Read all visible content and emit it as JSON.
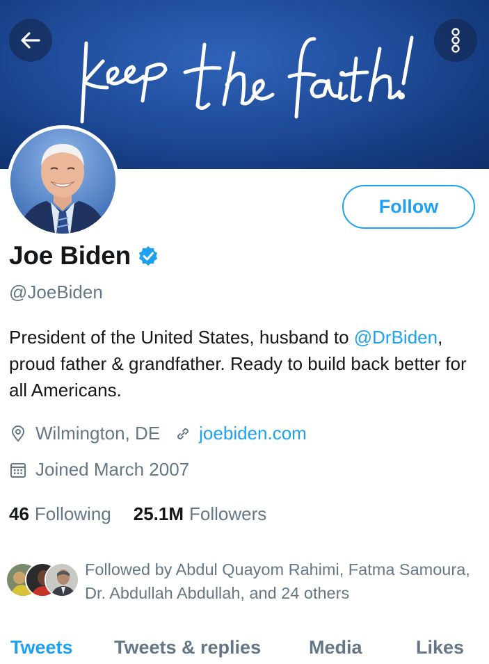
{
  "banner": {
    "script_text": "keep the faith!",
    "color": "#1f4c9a"
  },
  "header": {
    "back_icon": "arrow-left-icon",
    "more_icon": "more-vertical-icon"
  },
  "profile": {
    "name": "Joe Biden",
    "verified_icon": "verified-badge-icon",
    "handle": "@JoeBiden",
    "follow_label": "Follow",
    "bio_part1": "President of the United States, husband to ",
    "bio_mention": "@DrBiden",
    "bio_part2": ", proud father & grandfather. Ready to build back better for all Americans.",
    "location": "Wilmington, DE",
    "website": "joebiden.com",
    "joined": "Joined March 2007"
  },
  "stats": {
    "following_count": "46",
    "following_label": "Following",
    "followers_count": "25.1M",
    "followers_label": "Followers"
  },
  "followed_by": {
    "text": "Followed by Abdul Quayom Rahimi, Fatma Samoura, Dr. Abdullah Abdullah, and 24 others"
  },
  "tabs": [
    {
      "label": "Tweets",
      "active": true
    },
    {
      "label": "Tweets & replies",
      "active": false
    },
    {
      "label": "Media",
      "active": false
    },
    {
      "label": "Likes",
      "active": false
    }
  ],
  "colors": {
    "accent": "#1da1f2",
    "secondary_text": "#657786",
    "primary_text": "#14171a"
  }
}
